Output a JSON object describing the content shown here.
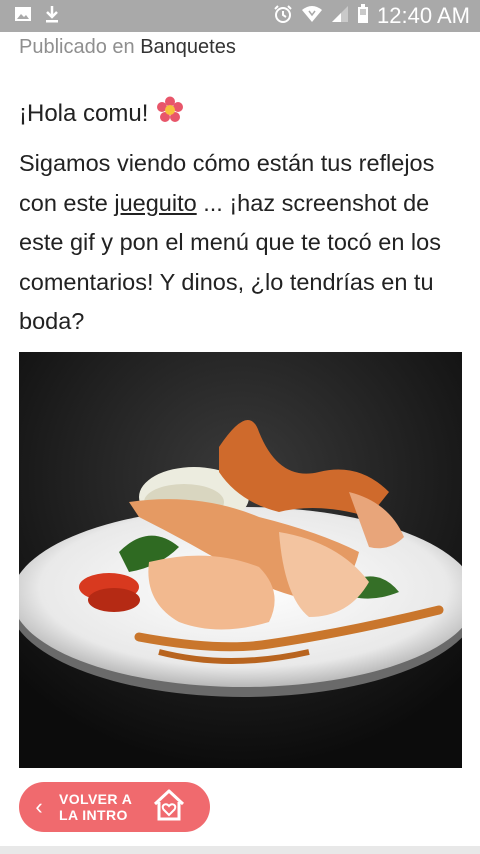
{
  "status_bar": {
    "time": "12:40 AM",
    "icons": [
      "image-icon",
      "download-icon",
      "alarm-icon",
      "wifi-icon",
      "signal-icon",
      "battery-icon"
    ]
  },
  "post": {
    "published_prefix": "Publicado en",
    "category": "Banquetes",
    "greeting": "¡Hola comu!",
    "greeting_icon": "flower-icon",
    "body_part1": "Sigamos viendo cómo están tus reflejos con este ",
    "body_link": "jueguito",
    "body_part2": " ... ¡haz screenshot de este gif y pon el menú que te tocó en los comentarios! Y dinos, ¿lo tendrías en tu boda?"
  },
  "back_button": {
    "label_line1": "VOLVER A",
    "label_line2": "LA INTRO",
    "icon": "home-heart-icon"
  },
  "colors": {
    "status_bar": "#a9a9a9",
    "accent": "#f06a6e"
  }
}
